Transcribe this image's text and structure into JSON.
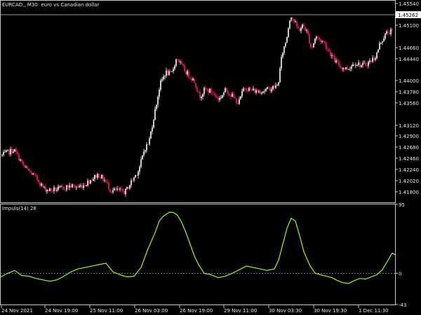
{
  "window": {
    "title": "EURCAD,, M30:  euro vs Canadian dollar"
  },
  "indicator": {
    "title": "Impuls(14) 28"
  },
  "colors": {
    "background": "#000000",
    "frame": "#c8c8c8",
    "candle_up": "#ffffff",
    "candle_down": "#ff1a66",
    "line": "#9aff00",
    "zero_line": "#808080",
    "current_price_line": "#c8c8c8"
  },
  "chart_data": [
    {
      "type": "candlestick",
      "title": "EURCAD,, M30:  euro vs Canadian dollar",
      "y_ticks": [
        "1.45540",
        "1.45100",
        "1.44660",
        "1.44440",
        "1.44000",
        "1.43780",
        "1.43560",
        "1.43120",
        "1.42900",
        "1.42680",
        "1.42460",
        "1.42240",
        "1.42020",
        "1.41800"
      ],
      "current_price": "1.45262",
      "ylim": [
        1.4163,
        1.4567
      ],
      "x_ticks": [
        "24 Nov 2021",
        "24 Nov 19:00",
        "25 Nov 11:00",
        "26 Nov 03:00",
        "26 Nov 19:00",
        "29 Nov 11:00",
        "30 Nov 03:30",
        "30 Nov 19:30",
        "1 Dec 11:30"
      ],
      "close_path": [
        [
          0,
          1.4254
        ],
        [
          10,
          1.4262
        ],
        [
          20,
          1.4268
        ],
        [
          25,
          1.4256
        ],
        [
          35,
          1.4232
        ],
        [
          45,
          1.422
        ],
        [
          55,
          1.4205
        ],
        [
          62,
          1.419
        ],
        [
          70,
          1.4186
        ],
        [
          80,
          1.4188
        ],
        [
          90,
          1.419
        ],
        [
          100,
          1.4195
        ],
        [
          110,
          1.4192
        ],
        [
          120,
          1.4197
        ],
        [
          130,
          1.4208
        ],
        [
          140,
          1.4218
        ],
        [
          150,
          1.4205
        ],
        [
          158,
          1.4185
        ],
        [
          168,
          1.4186
        ],
        [
          178,
          1.4182
        ],
        [
          188,
          1.4205
        ],
        [
          198,
          1.4228
        ],
        [
          206,
          1.427
        ],
        [
          212,
          1.4282
        ],
        [
          220,
          1.434
        ],
        [
          228,
          1.44
        ],
        [
          236,
          1.4425
        ],
        [
          244,
          1.442
        ],
        [
          252,
          1.4455
        ],
        [
          258,
          1.444
        ],
        [
          265,
          1.4425
        ],
        [
          272,
          1.4415
        ],
        [
          278,
          1.4405
        ],
        [
          284,
          1.4375
        ],
        [
          292,
          1.439
        ],
        [
          302,
          1.4385
        ],
        [
          312,
          1.437
        ],
        [
          322,
          1.439
        ],
        [
          332,
          1.4375
        ],
        [
          340,
          1.4362
        ],
        [
          348,
          1.4395
        ],
        [
          356,
          1.439
        ],
        [
          366,
          1.4386
        ],
        [
          376,
          1.4388
        ],
        [
          386,
          1.4392
        ],
        [
          396,
          1.4398
        ],
        [
          402,
          1.4462
        ],
        [
          408,
          1.449
        ],
        [
          414,
          1.4542
        ],
        [
          420,
          1.4525
        ],
        [
          426,
          1.451
        ],
        [
          432,
          1.452
        ],
        [
          438,
          1.4505
        ],
        [
          444,
          1.4472
        ],
        [
          450,
          1.4498
        ],
        [
          456,
          1.449
        ],
        [
          462,
          1.4485
        ],
        [
          468,
          1.447
        ],
        [
          476,
          1.445
        ],
        [
          486,
          1.4435
        ],
        [
          496,
          1.4432
        ],
        [
          506,
          1.4445
        ],
        [
          516,
          1.4438
        ],
        [
          526,
          1.4445
        ],
        [
          536,
          1.4458
        ],
        [
          542,
          1.4485
        ],
        [
          548,
          1.4498
        ],
        [
          552,
          1.4506
        ],
        [
          561,
          1.4508
        ]
      ]
    },
    {
      "type": "line",
      "title": "Impuls(14) 28",
      "y_ticks": [
        "95",
        "0",
        "-43"
      ],
      "ylim": [
        -43,
        95
      ],
      "x": [
        0,
        10,
        20,
        30,
        40,
        50,
        60,
        70,
        80,
        90,
        100,
        110,
        120,
        130,
        140,
        150,
        160,
        170,
        180,
        190,
        200,
        210,
        220,
        226,
        232,
        240,
        246,
        252,
        258,
        264,
        270,
        276,
        282,
        290,
        300,
        310,
        320,
        330,
        340,
        350,
        360,
        370,
        380,
        390,
        396,
        402,
        408,
        414,
        420,
        426,
        432,
        440,
        448,
        456,
        464,
        472,
        480,
        488,
        496,
        504,
        512,
        520,
        528,
        536,
        544,
        552,
        558,
        563
      ],
      "values": [
        -5,
        0,
        4,
        -3,
        -4,
        -7,
        -9,
        -11,
        -9,
        -4,
        2,
        6,
        8,
        10,
        12,
        14,
        2,
        -2,
        -5,
        -4,
        8,
        34,
        56,
        72,
        79,
        84,
        84,
        80,
        70,
        56,
        40,
        24,
        12,
        0,
        -2,
        -6,
        -4,
        0,
        5,
        10,
        8,
        6,
        4,
        6,
        18,
        40,
        62,
        76,
        72,
        52,
        30,
        12,
        0,
        -2,
        -4,
        -6,
        -10,
        -13,
        -14,
        -10,
        -7,
        -8,
        -5,
        -2,
        5,
        18,
        28,
        25
      ]
    }
  ]
}
